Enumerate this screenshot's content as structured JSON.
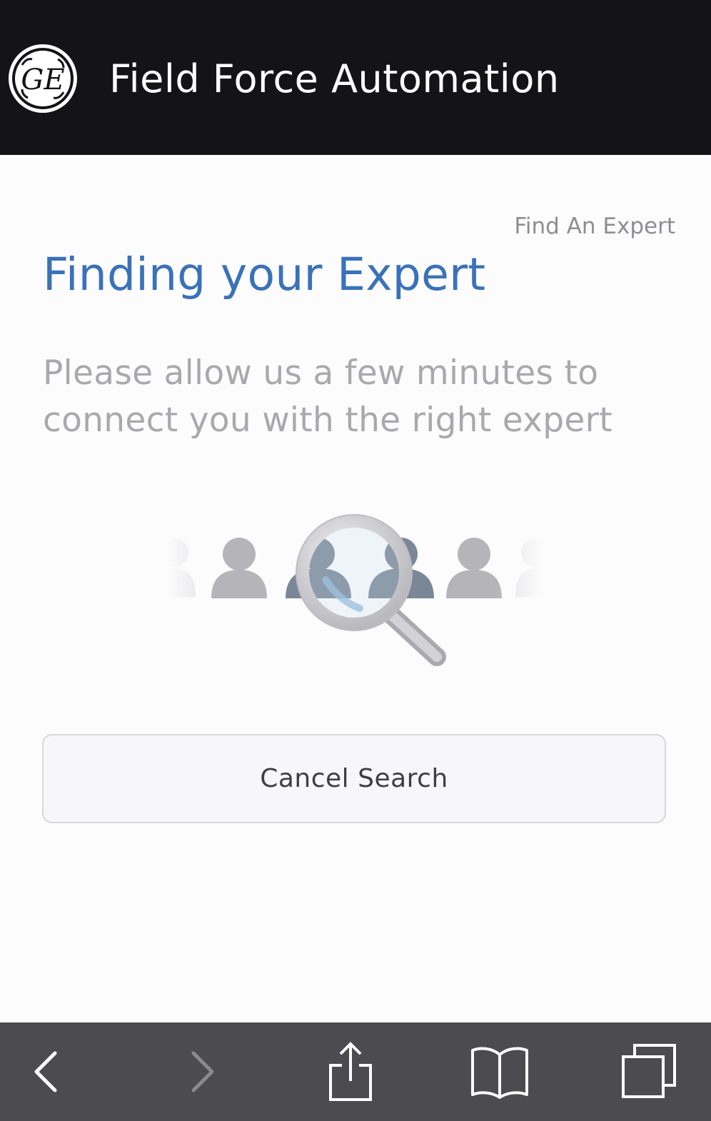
{
  "header": {
    "logo_icon": "ge-logo-icon",
    "title": "Field Force Automation"
  },
  "content": {
    "breadcrumb": "Find An Expert",
    "heading": "Finding your Expert",
    "description": "Please allow us a few minutes to connect you with the right expert",
    "illustration_icon": "searching-experts-magnifier-icon",
    "cancel_label": "Cancel Search"
  },
  "toolbar": {
    "items": [
      {
        "icon": "back-arrow-icon",
        "enabled": true
      },
      {
        "icon": "forward-arrow-icon",
        "enabled": false
      },
      {
        "icon": "share-icon",
        "enabled": true
      },
      {
        "icon": "bookmarks-book-icon",
        "enabled": true
      },
      {
        "icon": "tabs-icon",
        "enabled": true
      }
    ]
  },
  "colors": {
    "header_bg": "#141316",
    "heading_blue": "#3a72b9",
    "muted_text": "#a9a8ac",
    "toolbar_bg": "#4c4b50"
  }
}
